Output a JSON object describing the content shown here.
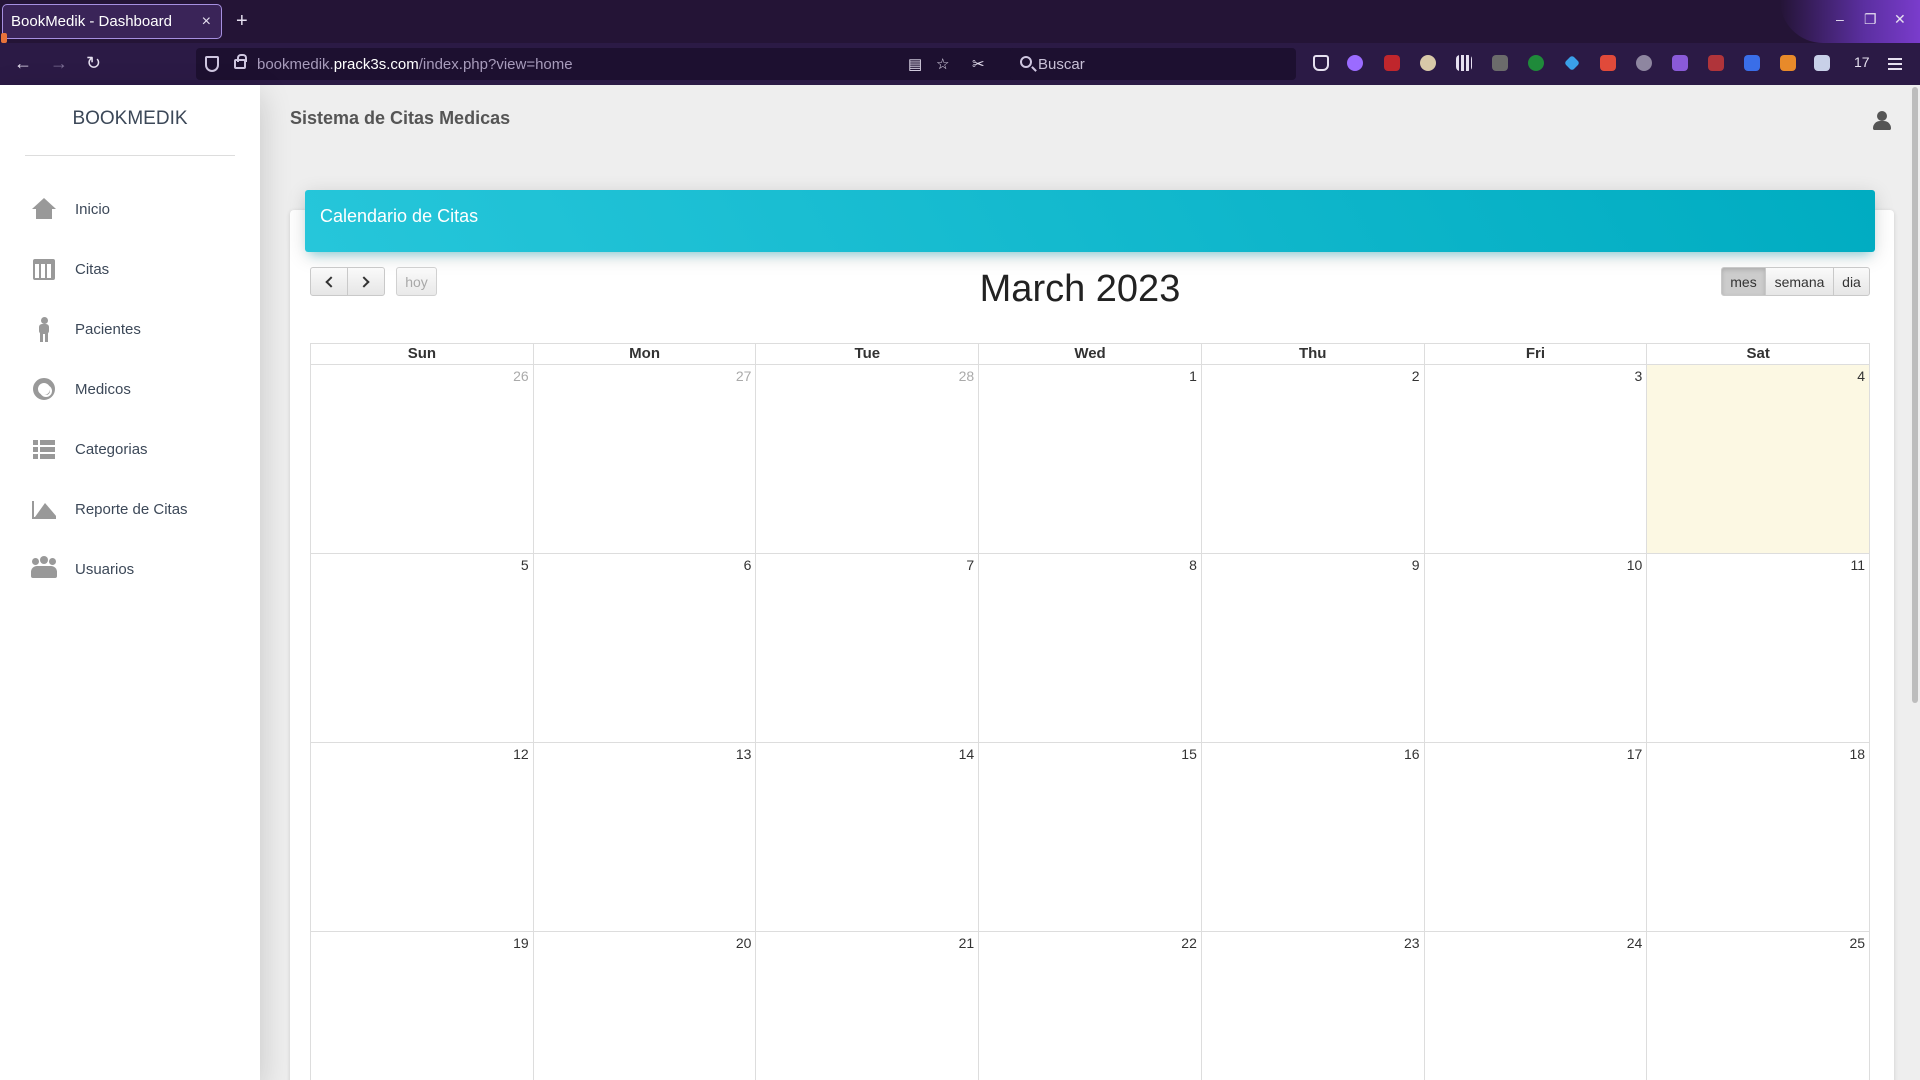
{
  "browser": {
    "tab_title": "BookMedik - Dashboard",
    "tab_close": "×",
    "new_tab": "+",
    "url_domain": "bookmedik.",
    "url_host": "prack3s.com",
    "url_path": "/index.php?view=home",
    "search_placeholder": "Buscar",
    "extensions_count": "17",
    "window_minimize": "–",
    "window_restore": "❐",
    "window_close": "✕"
  },
  "sidebar": {
    "brand": "BOOKMEDIK",
    "items": [
      {
        "label": "Inicio",
        "icon": "home-icon"
      },
      {
        "label": "Citas",
        "icon": "calendar-icon"
      },
      {
        "label": "Pacientes",
        "icon": "person-walking-icon"
      },
      {
        "label": "Medicos",
        "icon": "life-ring-icon"
      },
      {
        "label": "Categorias",
        "icon": "list-icon"
      },
      {
        "label": "Reporte de Citas",
        "icon": "area-chart-icon"
      },
      {
        "label": "Usuarios",
        "icon": "users-icon"
      }
    ]
  },
  "header": {
    "title": "Sistema de Citas Medicas",
    "user_icon": "user-icon"
  },
  "calendar": {
    "card_title": "Calendario de Citas",
    "month_title": "March 2023",
    "today_label": "hoy",
    "views": [
      "mes",
      "semana",
      "dia"
    ],
    "active_view": "mes",
    "weekdays": [
      "Sun",
      "Mon",
      "Tue",
      "Wed",
      "Thu",
      "Fri",
      "Sat"
    ],
    "weeks": [
      [
        "26",
        "27",
        "28",
        "1",
        "2",
        "3",
        "4"
      ],
      [
        "5",
        "6",
        "7",
        "8",
        "9",
        "10",
        "11"
      ],
      [
        "12",
        "13",
        "14",
        "15",
        "16",
        "17",
        "18"
      ],
      [
        "19",
        "20",
        "21",
        "22",
        "23",
        "24",
        "25"
      ]
    ],
    "today_date": "4",
    "colors": {
      "header_gradient_start": "#26c6da",
      "header_gradient_end": "#00acc1",
      "today_highlight": "#fcf8e3"
    }
  }
}
